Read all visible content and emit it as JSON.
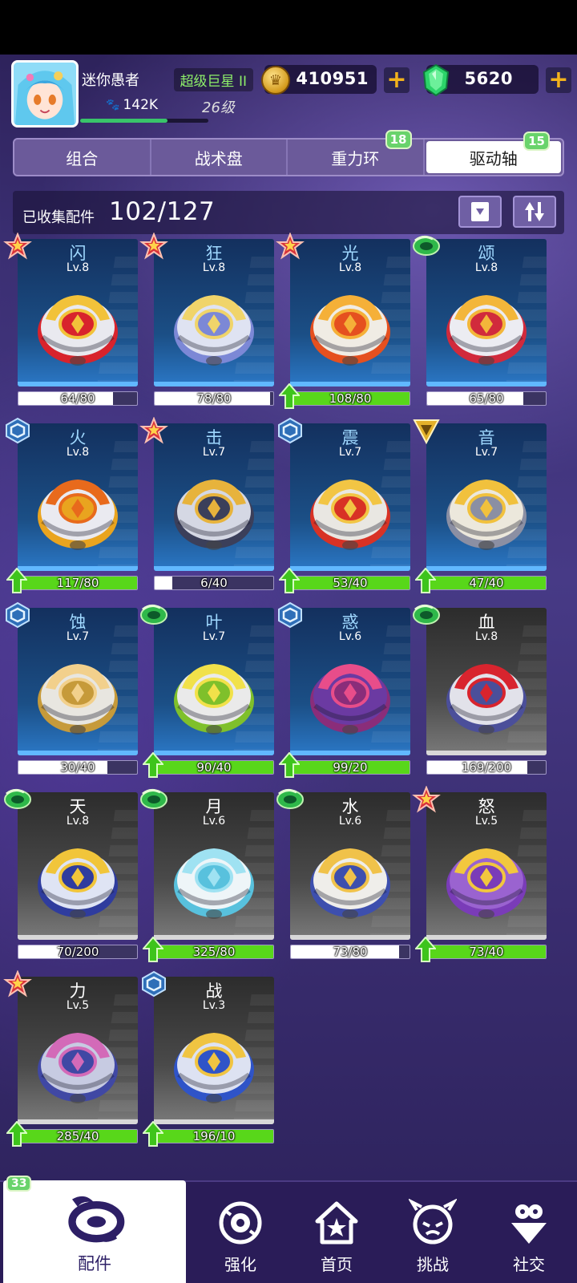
{
  "player": {
    "name": "迷你愚者",
    "title": "超级巨星 II",
    "power": "142K",
    "level": "26级",
    "exp_fraction": 0.68
  },
  "currency": {
    "coins": "410951",
    "gems": "5620"
  },
  "tabs": [
    {
      "label": "组合",
      "badge": ""
    },
    {
      "label": "战术盘",
      "badge": ""
    },
    {
      "label": "重力环",
      "badge": "18"
    },
    {
      "label": "驱动轴",
      "badge": "15",
      "active": true
    }
  ],
  "collection": {
    "label": "已收集配件",
    "count": "102/127"
  },
  "cards": [
    {
      "name": "闪",
      "level": "Lv.8",
      "progress": "64/80",
      "rarity": "star",
      "upgrade": false,
      "gray": false,
      "fill": 0.8,
      "colors": [
        "#d8232c",
        "#f2c23a",
        "#e9e9ef"
      ]
    },
    {
      "name": "狂",
      "level": "Lv.8",
      "progress": "78/80",
      "rarity": "star",
      "upgrade": false,
      "gray": false,
      "fill": 0.975,
      "colors": [
        "#7c88d6",
        "#f0d46a",
        "#dfe3f2"
      ]
    },
    {
      "name": "光",
      "level": "Lv.8",
      "progress": "108/80",
      "rarity": "star",
      "upgrade": true,
      "gray": false,
      "fill": 1,
      "colors": [
        "#e5501f",
        "#f5b038",
        "#f0ece4"
      ]
    },
    {
      "name": "颂",
      "level": "Lv.8",
      "progress": "65/80",
      "rarity": "swirl",
      "upgrade": false,
      "gray": false,
      "fill": 0.8125,
      "colors": [
        "#d12a3c",
        "#f3b63a",
        "#ececf2"
      ]
    },
    {
      "name": "火",
      "level": "Lv.8",
      "progress": "117/80",
      "rarity": "hex",
      "upgrade": true,
      "gray": false,
      "fill": 1,
      "colors": [
        "#e9a41f",
        "#e86a1c",
        "#eaeaf0"
      ]
    },
    {
      "name": "击",
      "level": "Lv.7",
      "progress": "6/40",
      "rarity": "star",
      "upgrade": false,
      "gray": false,
      "fill": 0.15,
      "colors": [
        "#3b3f5a",
        "#e7b33c",
        "#d5d8e4"
      ]
    },
    {
      "name": "震",
      "level": "Lv.7",
      "progress": "53/40",
      "rarity": "hex",
      "upgrade": true,
      "gray": false,
      "fill": 1,
      "colors": [
        "#d83225",
        "#f2c544",
        "#e9e7e2"
      ]
    },
    {
      "name": "音",
      "level": "Lv.7",
      "progress": "47/40",
      "rarity": "triangle",
      "upgrade": true,
      "gray": false,
      "fill": 1,
      "colors": [
        "#8b8fa3",
        "#f1c13d",
        "#ece8dc"
      ]
    },
    {
      "name": "蚀",
      "level": "Lv.7",
      "progress": "30/40",
      "rarity": "hex",
      "upgrade": false,
      "gray": false,
      "fill": 0.75,
      "colors": [
        "#c69a3a",
        "#f2d08c",
        "#e8e6e0"
      ]
    },
    {
      "name": "叶",
      "level": "Lv.7",
      "progress": "90/40",
      "rarity": "swirl",
      "upgrade": true,
      "gray": false,
      "fill": 1,
      "colors": [
        "#7fc02b",
        "#f1e14a",
        "#eaeaea"
      ]
    },
    {
      "name": "惑",
      "level": "Lv.6",
      "progress": "99/20",
      "rarity": "hex",
      "upgrade": true,
      "gray": false,
      "fill": 1,
      "colors": [
        "#8a2d7a",
        "#e84d8a",
        "#6b3aa2"
      ]
    },
    {
      "name": "血",
      "level": "Lv.8",
      "progress": "169/200",
      "rarity": "swirl",
      "upgrade": false,
      "gray": true,
      "fill": 0.845,
      "colors": [
        "#4b4f9a",
        "#d8242e",
        "#e2e2ea"
      ]
    },
    {
      "name": "天",
      "level": "Lv.8",
      "progress": "70/200",
      "rarity": "swirl",
      "upgrade": false,
      "gray": true,
      "fill": 0.35,
      "colors": [
        "#2f3c9e",
        "#f1c53a",
        "#dfe4f4"
      ]
    },
    {
      "name": "月",
      "level": "Lv.6",
      "progress": "325/80",
      "rarity": "swirl",
      "upgrade": true,
      "gray": true,
      "fill": 1,
      "colors": [
        "#58c1dd",
        "#9fe2f2",
        "#eef5f8"
      ]
    },
    {
      "name": "水",
      "level": "Lv.6",
      "progress": "73/80",
      "rarity": "swirl",
      "upgrade": false,
      "gray": true,
      "fill": 0.9125,
      "colors": [
        "#3d4fae",
        "#f0c24a",
        "#efeeea"
      ]
    },
    {
      "name": "怒",
      "level": "Lv.5",
      "progress": "73/40",
      "rarity": "star",
      "upgrade": true,
      "gray": true,
      "fill": 1,
      "colors": [
        "#7a3cb8",
        "#f2c73e",
        "#9a63d0"
      ]
    },
    {
      "name": "力",
      "level": "Lv.5",
      "progress": "285/40",
      "rarity": "star",
      "upgrade": true,
      "gray": true,
      "fill": 1,
      "colors": [
        "#4048a4",
        "#d36ab8",
        "#c7cbe2"
      ]
    },
    {
      "name": "战",
      "level": "Lv.3",
      "progress": "196/10",
      "rarity": "hex",
      "upgrade": true,
      "gray": true,
      "fill": 1,
      "colors": [
        "#2f54c8",
        "#f0c442",
        "#dde2f2"
      ]
    }
  ],
  "nav": {
    "badge": "33",
    "parts": "配件",
    "enhance": "强化",
    "home": "首页",
    "challenge": "挑战",
    "social": "社交"
  },
  "icons": {
    "coin": "coin-icon",
    "gem": "gem-icon",
    "filter": "filter-icon",
    "sort": "sort-icon",
    "rarity_types": [
      "star",
      "swirl",
      "hex",
      "triangle"
    ]
  },
  "colors": {
    "accent_green": "#58d71a",
    "gold": "#f2b21c",
    "active_tab": "#ffffff",
    "tab_bar": "#6b5a9a"
  }
}
